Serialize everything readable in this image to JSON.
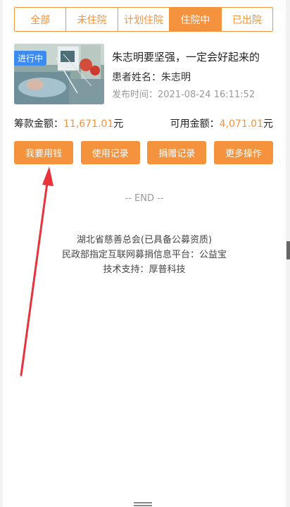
{
  "tabs": [
    "全部",
    "未住院",
    "计划住院",
    "住院中",
    "已出院"
  ],
  "active_tab": 3,
  "card": {
    "status": "进行中",
    "title": "朱志明要坚强，一定会好起来的",
    "patient_label": "患者姓名：",
    "patient_name": "朱志明",
    "time_label": "发布时间：",
    "time": "2021-08-24 16:11:52"
  },
  "amounts": {
    "raised_label": "筹款金额：",
    "raised": "11,671.01",
    "available_label": "可用金额：",
    "available": "4,071.01",
    "unit": "元"
  },
  "actions": [
    "我要用钱",
    "使用记录",
    "捐赠记录",
    "更多操作"
  ],
  "end_text": "-- END --",
  "footer": [
    "湖北省慈善总会(已具备公募资质)",
    "民政部指定互联网募捐信息平台：公益宝",
    "技术支持：厚普科技"
  ],
  "colors": {
    "accent": "#f5923e",
    "badge": "#3d8bf2",
    "annotation_arrow": "#e8323c"
  }
}
